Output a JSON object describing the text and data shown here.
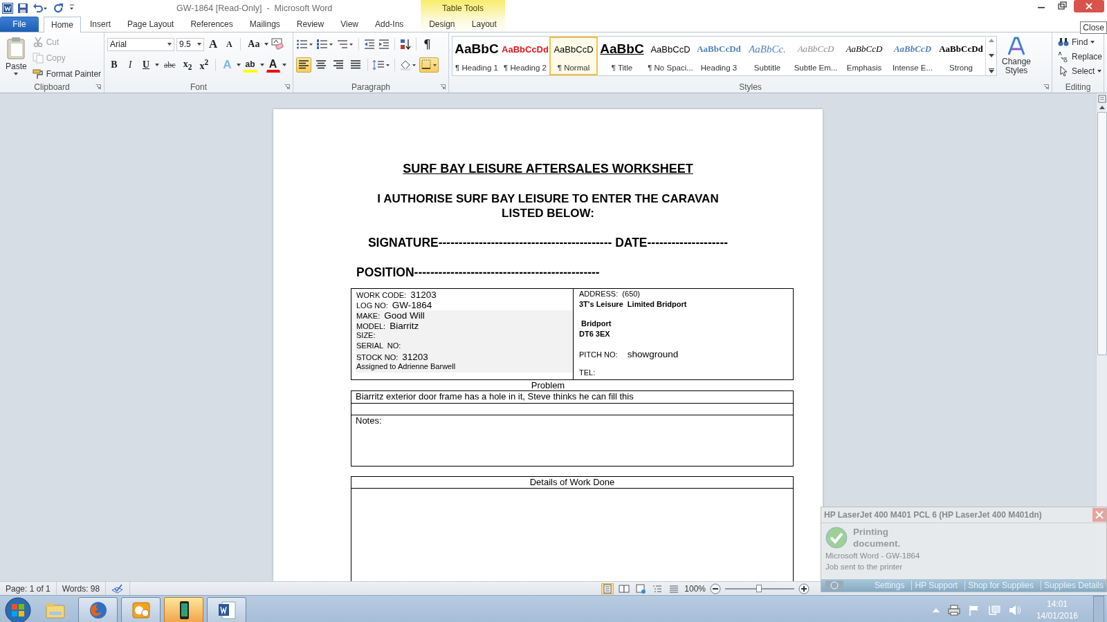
{
  "title_bar": {
    "title": "GW-1864 [Read-Only]  -  Microsoft Word",
    "context_group": "Table Tools"
  },
  "tooltip": "Close",
  "ribbon_tabs": [
    {
      "label": "File",
      "kind": "file",
      "selected": false
    },
    {
      "label": "Home",
      "kind": "main",
      "selected": true
    },
    {
      "label": "Insert",
      "kind": "main",
      "selected": false
    },
    {
      "label": "Page Layout",
      "kind": "main",
      "selected": false
    },
    {
      "label": "References",
      "kind": "main",
      "selected": false
    },
    {
      "label": "Mailings",
      "kind": "main",
      "selected": false
    },
    {
      "label": "Review",
      "kind": "main",
      "selected": false
    },
    {
      "label": "View",
      "kind": "main",
      "selected": false
    },
    {
      "label": "Add-Ins",
      "kind": "main",
      "selected": false
    },
    {
      "label": "Design",
      "kind": "context",
      "selected": false
    },
    {
      "label": "Layout",
      "kind": "context",
      "selected": false
    }
  ],
  "clipboard": {
    "label": "Clipboard",
    "paste": "Paste",
    "buttons": [
      {
        "kind": "cut",
        "label": "Cut",
        "disabled": true
      },
      {
        "kind": "copy",
        "label": "Copy",
        "disabled": true
      },
      {
        "kind": "painter",
        "label": "Format Painter",
        "disabled": false
      }
    ]
  },
  "font": {
    "label": "Font",
    "name": "Arial",
    "size": "9.5",
    "row1": [
      {
        "kind": "grow",
        "label": "A"
      },
      {
        "kind": "shrink",
        "label": "A"
      },
      {
        "kind": "case",
        "label": "Aa"
      }
    ],
    "row2": [
      {
        "kind": "bold",
        "label": "B"
      },
      {
        "kind": "italic",
        "label": "I"
      },
      {
        "kind": "underline",
        "label": "U"
      },
      {
        "kind": "strike",
        "label": "abc"
      },
      {
        "kind": "sub",
        "label": "x$_{2}$"
      },
      {
        "kind": "sup",
        "label": "x$^{2}$"
      },
      {
        "kind": "effects",
        "label": "A"
      },
      {
        "kind": "highlight",
        "label": "ab"
      },
      {
        "kind": "color",
        "label": "A"
      }
    ]
  },
  "paragraph": {
    "label": "Paragraph",
    "pilcrow": "¶",
    "align": [
      {
        "kind": "left",
        "selected": true
      },
      {
        "kind": "center",
        "selected": false
      },
      {
        "kind": "right",
        "selected": false
      },
      {
        "kind": "justify",
        "selected": false
      }
    ],
    "borders_selected": true
  },
  "styles": {
    "label": "Styles",
    "change": "Change Styles",
    "items": [
      {
        "kind": "heading1",
        "preview": "AaBbC",
        "label": "¶ Heading 1",
        "selected": false
      },
      {
        "kind": "heading2",
        "preview": "AaBbCcDd",
        "label": "¶ Heading 2",
        "selected": false
      },
      {
        "kind": "normal",
        "preview": "AaBbCcD",
        "label": "¶ Normal",
        "selected": true
      },
      {
        "kind": "title",
        "preview": "AaBbC",
        "label": "¶ Title",
        "selected": false
      },
      {
        "kind": "nospacing",
        "preview": "AaBbCcD",
        "label": "¶ No Spaci...",
        "selected": false
      },
      {
        "kind": "heading3",
        "preview": "AaBbCcDd",
        "label": "Heading 3",
        "selected": false
      },
      {
        "kind": "subtitle",
        "preview": "AaBbCc.",
        "label": "Subtitle",
        "selected": false
      },
      {
        "kind": "subtle",
        "preview": "AaBbCcD",
        "label": "Subtle Em...",
        "selected": false
      },
      {
        "kind": "emphasis",
        "preview": "AaBbCcD",
        "label": "Emphasis",
        "selected": false
      },
      {
        "kind": "intense",
        "preview": "AaBbCcD",
        "label": "Intense E...",
        "selected": false
      },
      {
        "kind": "strong",
        "preview": "AaBbCcDd",
        "label": "Strong",
        "selected": false
      }
    ]
  },
  "editing": {
    "label": "Editing",
    "buttons": [
      {
        "kind": "find",
        "label": "Find"
      },
      {
        "kind": "replace",
        "label": "Replace"
      },
      {
        "kind": "select",
        "label": "Select"
      }
    ]
  },
  "document": {
    "title": "SURF BAY LEISURE AFTERSALES WORKSHEET",
    "authorise": "I AUTHORISE SURF BAY LEISURE TO ENTER THE CARAVAN\nLISTED BELOW:",
    "signature": "SIGNATURE------------------------------------------- DATE--------------------",
    "position": "POSITION----------------------------------------------",
    "left_cell": [
      {
        "label": "WORK CODE:",
        "value": "31203",
        "shaded": false
      },
      {
        "label": "LOG NO:",
        "value": "GW-1864",
        "shaded": false
      },
      {
        "label": "MAKE:",
        "value": "Good Will",
        "shaded": true
      },
      {
        "label": "MODEL:",
        "value": "Biarritz",
        "shaded": true
      },
      {
        "label": "SIZE:",
        "shaded": true
      },
      {
        "label": "SERIAL  NO:",
        "shaded": true
      },
      {
        "label": "STOCK NO:",
        "value": "31203",
        "shaded": true
      },
      {
        "label": "Assigned to Adrienne Barwell",
        "shaded": true
      }
    ],
    "right_cell": [
      [
        {
          "kind": "label",
          "text": "ADDRESS:  (650)"
        },
        {
          "kind": "bold",
          "text": "3T's Leisure  Limited Bridport"
        }
      ],
      [
        {
          "kind": "bold",
          "text": " Bridport"
        },
        {
          "kind": "bold",
          "text": "DT6 3EX"
        }
      ],
      [
        {
          "kind": "field",
          "label": "PITCH NO:",
          "value": "showground"
        }
      ],
      [
        {
          "kind": "field",
          "label": "TEL:"
        }
      ]
    ],
    "problem_label": "Problem",
    "problem": "Biarritz exterior door frame has a hole in it, Steve thinks he can fill this",
    "notes": "Notes:",
    "details": "Details of Work Done"
  },
  "status_bar": {
    "page": "Page: 1 of 1",
    "words": "Words: 98",
    "zoom": "100%",
    "zoom_level": {
      "level": 0.5
    },
    "views": [
      {
        "kind": "print",
        "selected": true
      },
      {
        "kind": "reading",
        "selected": false
      },
      {
        "kind": "web",
        "selected": false
      },
      {
        "kind": "outline",
        "selected": false
      },
      {
        "kind": "draft",
        "selected": false
      }
    ]
  },
  "printer_popup": {
    "title": "HP LaserJet 400 M401 PCL 6 (HP LaserJet 400 M401dn)",
    "status": "Printing document.",
    "job": "Microsoft Word - GW-1864",
    "detail": "Job sent to the printer",
    "links": [
      "Settings",
      "HP Support",
      "Shop for Supplies",
      "Supplies Details"
    ]
  },
  "taskbar": {
    "apps": [
      {
        "kind": "explorer",
        "running": false,
        "highlighted": false
      },
      {
        "kind": "firefox",
        "running": true,
        "highlighted": false
      },
      {
        "kind": "outlook",
        "running": true,
        "highlighted": false
      },
      {
        "kind": "phone",
        "running": true,
        "highlighted": true
      },
      {
        "kind": "word",
        "running": true,
        "highlighted": false
      }
    ],
    "time": "14:01",
    "date": "14/01/2016"
  }
}
